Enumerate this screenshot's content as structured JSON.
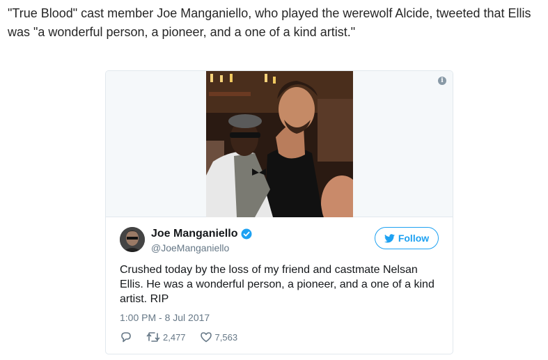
{
  "article": {
    "paragraph": "\"True Blood\" cast member Joe Manganiello, who played the werewolf Alcide, tweeted that Ellis was \"a wonderful person, a pioneer, and a one of a kind artist.\""
  },
  "tweet": {
    "author_name": "Joe Manganiello",
    "author_handle": "@JoeManganiello",
    "follow_label": "Follow",
    "text": "Crushed today by the loss of my friend and castmate Nelsan Ellis. He was a wonderful person, a pioneer, and a one of a kind artist. RIP",
    "timestamp": "1:00 PM - 8 Jul 2017",
    "retweet_count": "2,477",
    "like_count": "7,563"
  },
  "colors": {
    "accent": "#1da1f2",
    "muted": "#657786",
    "border": "#e1e8ed"
  },
  "icons": [
    "info-icon",
    "verified-icon",
    "bird-icon",
    "reply-icon",
    "retweet-icon",
    "like-icon"
  ]
}
